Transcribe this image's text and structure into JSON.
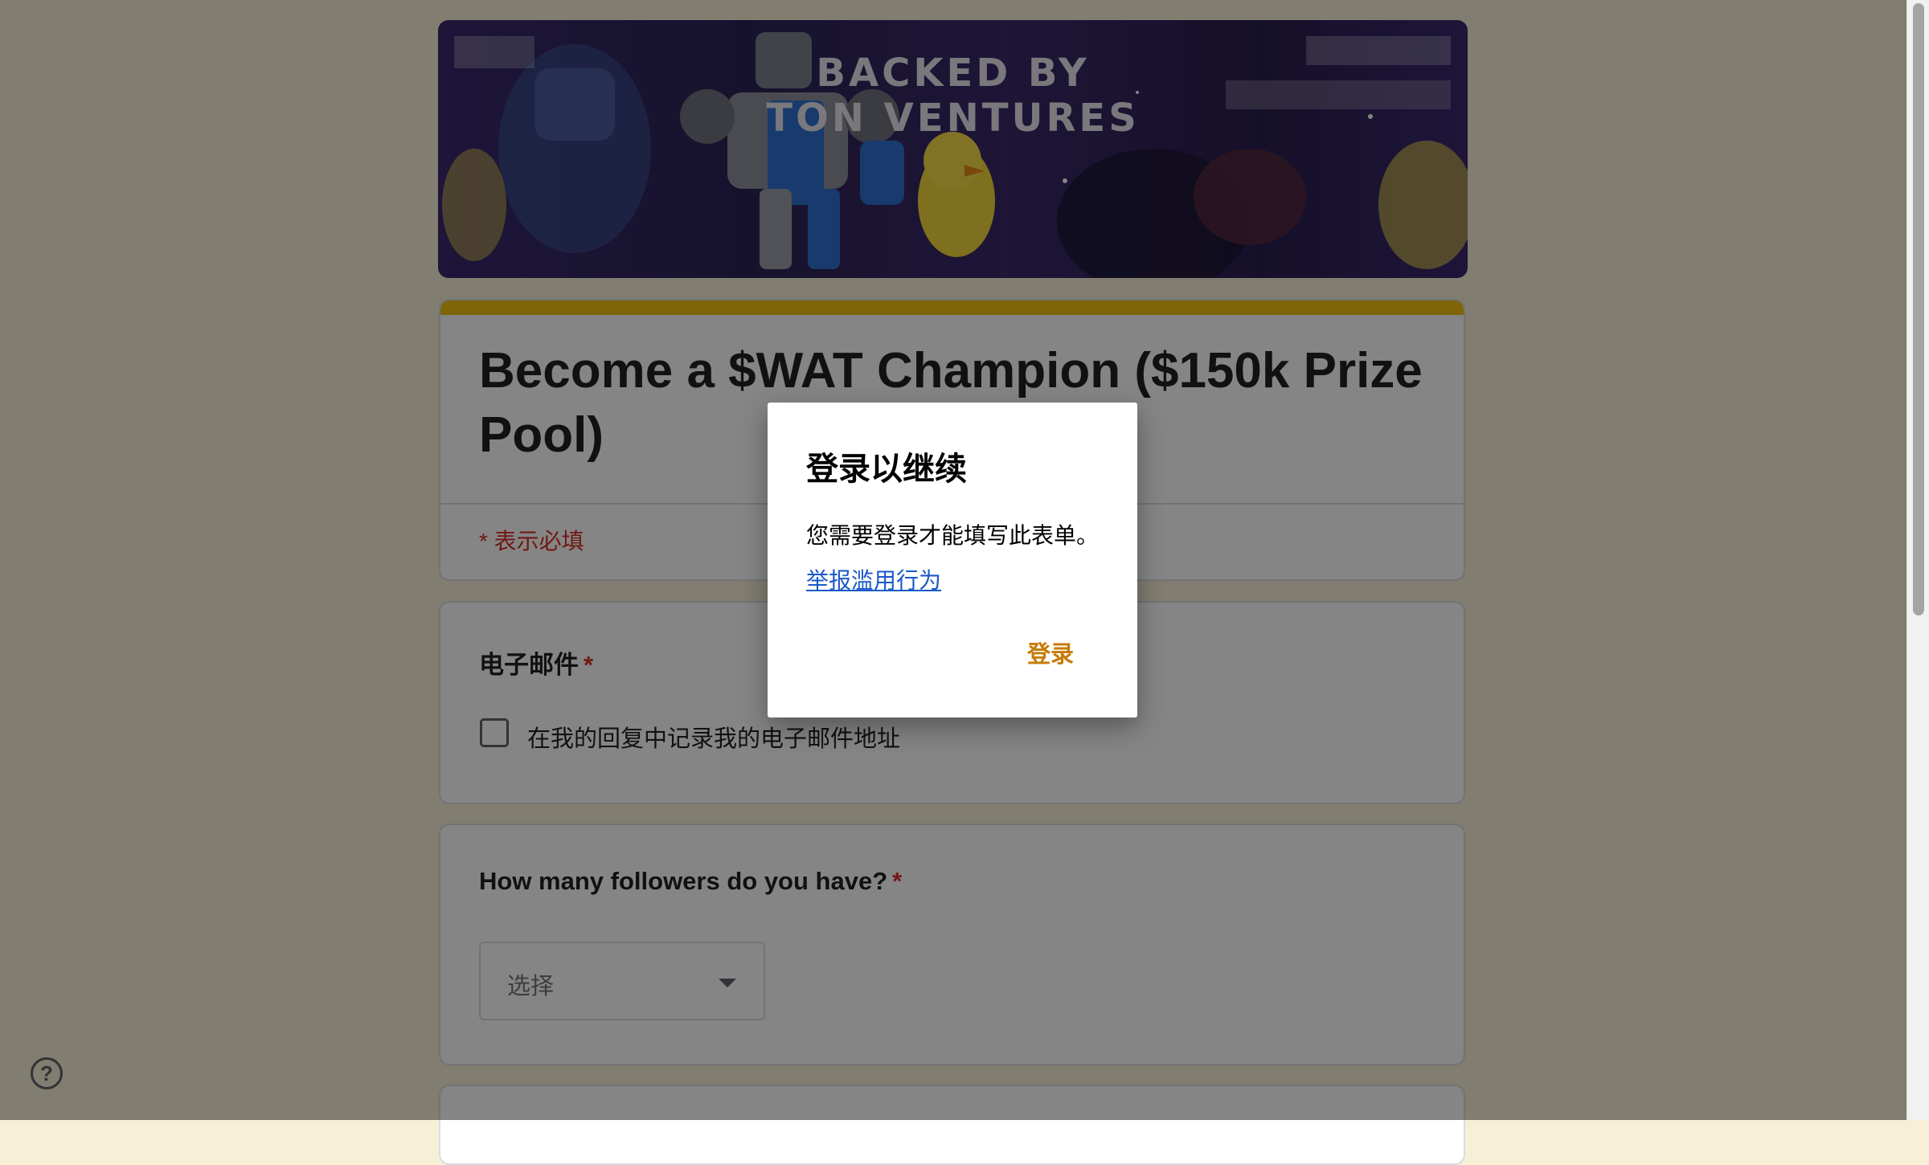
{
  "banner": {
    "line1": "BACKED BY",
    "line2": "TON VENTURES"
  },
  "form": {
    "title": "Become a $WAT Champion ($150k Prize Pool)",
    "required_note": "* 表示必填",
    "accent_color": "#f1c10f",
    "required_color": "#d93025"
  },
  "email_question": {
    "label": "电子邮件",
    "required_marker": "*",
    "checkbox_label": "在我的回复中记录我的电子邮件地址",
    "checked": false
  },
  "followers_question": {
    "label": "How many followers do you have?",
    "required_marker": "*",
    "select_placeholder": "选择"
  },
  "dialog": {
    "title": "登录以继续",
    "body": "您需要登录才能填写此表单。",
    "report_link": "举报滥用行为",
    "login_button": "登录",
    "button_color": "#c67b04",
    "link_color": "#1a59c9"
  },
  "help": {
    "icon": "help-icon",
    "glyph": "?"
  }
}
